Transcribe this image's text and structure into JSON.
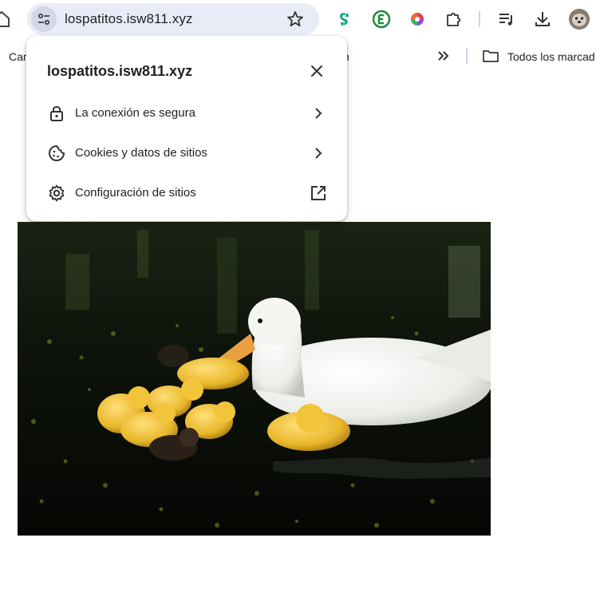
{
  "omnibox": {
    "url": "lospatitos.isw811.xyz",
    "site_info_icon": "tune-icon",
    "bookmark_icon": "star-icon"
  },
  "toolbar": {
    "extensions": [
      "grammar-extension-icon",
      "evernote-extension-icon",
      "color-wheel-extension-icon",
      "puzzle-extensions-icon"
    ],
    "media_icon": "media-queue-icon",
    "download_icon": "download-icon",
    "profile_icon": "avatar"
  },
  "bookmarks_bar": {
    "left_partial_label": "Car",
    "hidden_partial_label": "n",
    "overflow_icon": "double-chevron-icon",
    "all_bookmarks_label": "Todos los marcad"
  },
  "popup": {
    "title": "lospatitos.isw811.xyz",
    "close_icon": "close-icon",
    "rows": [
      {
        "label": "La conexión es segura",
        "icon": "lock-icon",
        "trail": "chevron-right-icon"
      },
      {
        "label": "Cookies y datos de sitios",
        "icon": "cookie-icon",
        "trail": "chevron-right-icon"
      },
      {
        "label": "Configuración de sitios",
        "icon": "gear-icon",
        "trail": "open-external-icon"
      }
    ]
  },
  "content": {
    "image_subject": "white duck with yellow ducklings swimming in dark pond"
  },
  "colors": {
    "omnibox_bg": "#e9ecf6",
    "accent": "#1a73e8",
    "text": "#1f1f1f"
  }
}
